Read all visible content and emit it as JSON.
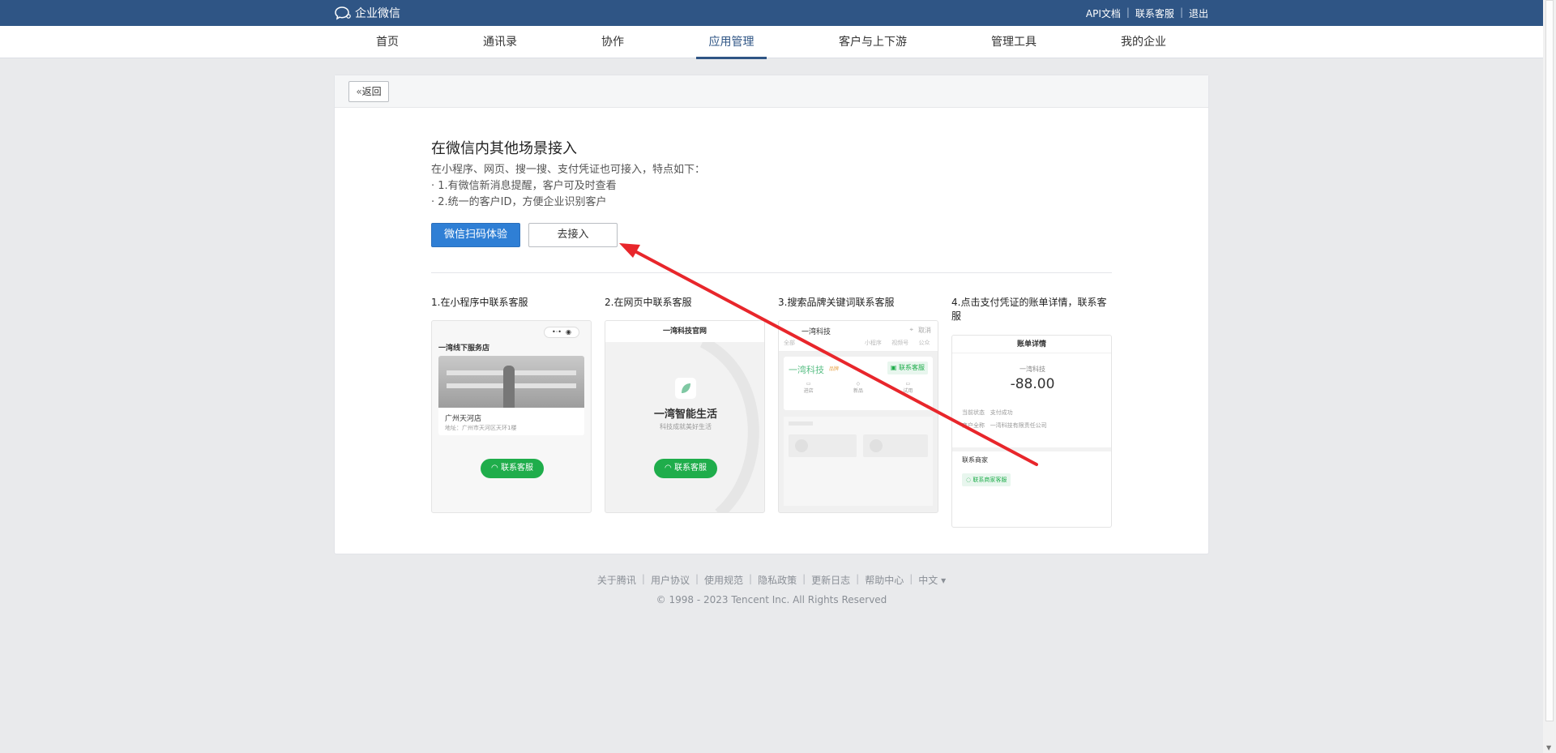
{
  "header": {
    "logo_text": "企业微信",
    "links": [
      "API文档",
      "联系客服",
      "退出"
    ]
  },
  "nav": {
    "items": [
      "首页",
      "通讯录",
      "协作",
      "应用管理",
      "客户与上下游",
      "管理工具",
      "我的企业"
    ],
    "active": "应用管理"
  },
  "card": {
    "back_label": "返回",
    "title": "在微信内其他场景接入",
    "desc_intro": "在小程序、网页、搜一搜、支付凭证也可接入，特点如下：",
    "desc_point1": "· 1.有微信新消息提醒，客户可及时查看",
    "desc_point2": "· 2.统一的客户ID，方便企业识别客户",
    "btn_scan": "微信扫码体验",
    "btn_connect": "去接入"
  },
  "steps": [
    {
      "label": "1.在小程序中联系客服"
    },
    {
      "label": "2.在网页中联系客服"
    },
    {
      "label": "3.搜索品牌关键词联系客服"
    },
    {
      "label": "4.点击支付凭证的账单详情，联系客服"
    }
  ],
  "mock1": {
    "store_title": "一湾线下服务店",
    "store_name": "广州天河店",
    "store_addr": "地址：广州市天河区天环1楼",
    "button": "联系客服"
  },
  "mock2": {
    "header": "一湾科技官网",
    "brand": "一湾智能生活",
    "slogan": "科技成就美好生活",
    "button": "联系客服"
  },
  "mock3": {
    "brand": "一湾科技",
    "cancel": "取消",
    "tabs": [
      "全部",
      "",
      "",
      "小程序",
      "视频号",
      "公众"
    ],
    "result_brand": "一湾科技",
    "result_tag": "品牌",
    "button": "联系客服",
    "icons": [
      "进店",
      "新品",
      "试用"
    ]
  },
  "mock4": {
    "header": "账单详情",
    "merchant": "一湾科技",
    "amount": "-88.00",
    "status_key": "当前状态",
    "status_val": "支付成功",
    "merchant_key": "商户全称",
    "merchant_val": "一湾科技有限责任公司",
    "contact_title": "联系商家",
    "contact_btn": "联系商家客服"
  },
  "footer": {
    "links": [
      "关于腾讯",
      "用户协议",
      "使用规范",
      "隐私政策",
      "更新日志",
      "帮助中心",
      "中文 ▾"
    ],
    "copyright": "© 1998 - 2023 Tencent Inc. All Rights Reserved"
  },
  "colors": {
    "topbar": "#2f5585",
    "primary": "#2f7fd5",
    "green": "#1fad4b",
    "annotation_arrow": "#e8262b"
  }
}
